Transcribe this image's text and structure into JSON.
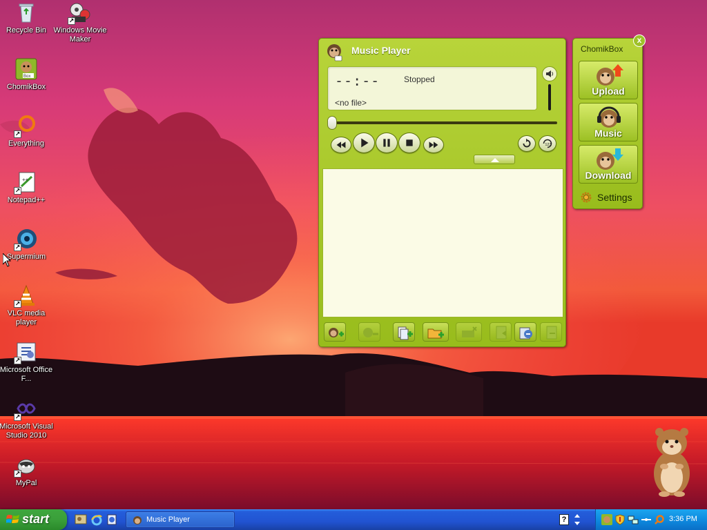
{
  "desktop": {
    "icons": [
      {
        "label": "Recycle Bin",
        "icon": "recycle-bin-icon"
      },
      {
        "label": "Windows Movie Maker",
        "icon": "movie-maker-icon"
      },
      {
        "label": "ChomikBox",
        "icon": "chomikbox-icon"
      },
      {
        "label": "Everything",
        "icon": "everything-icon"
      },
      {
        "label": "Notepad++",
        "icon": "notepad-plus-plus-icon"
      },
      {
        "label": "Supermium",
        "icon": "supermium-icon"
      },
      {
        "label": "VLC media player",
        "icon": "vlc-icon"
      },
      {
        "label": "Microsoft Office F...",
        "icon": "office-icon"
      },
      {
        "label": "Microsoft Visual Studio 2010",
        "icon": "visual-studio-icon"
      },
      {
        "label": "MyPal",
        "icon": "mypal-icon"
      }
    ]
  },
  "player": {
    "title": "Music Player",
    "time": "--:--",
    "status": "Stopped",
    "file": "<no file>",
    "colors": {
      "frame": "#a8c82a",
      "display": "#f3f6d8"
    }
  },
  "chomikbox": {
    "title": "ChomikBox",
    "close": "x",
    "buttons": [
      {
        "label": "Upload",
        "icon": "upload-icon"
      },
      {
        "label": "Music",
        "icon": "music-headphones-icon"
      },
      {
        "label": "Download",
        "icon": "download-icon"
      }
    ],
    "settings": "Settings"
  },
  "taskbar": {
    "start": "start",
    "task": "Music Player",
    "help": "?",
    "clock": "3:36 PM"
  }
}
